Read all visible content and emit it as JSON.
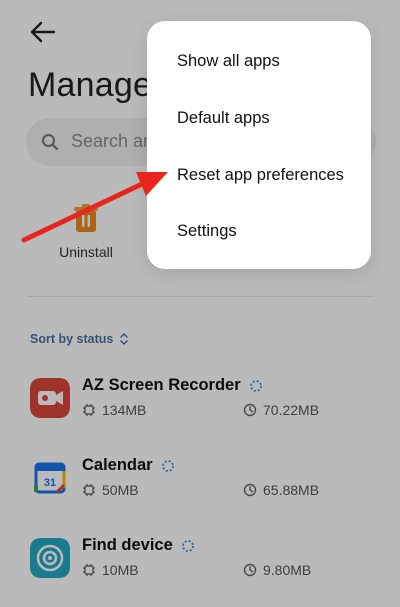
{
  "page": {
    "title": "Manage",
    "search_placeholder": "Search ar"
  },
  "actions": {
    "uninstall_label": "Uninstall"
  },
  "sort": {
    "label": "Sort by status"
  },
  "apps": [
    {
      "name": "AZ Screen Recorder",
      "storage": "134MB",
      "time": "70.22MB",
      "icon": "screen-recorder-icon",
      "color": "#d8463a"
    },
    {
      "name": "Calendar",
      "storage": "50MB",
      "time": "65.88MB",
      "icon": "calendar-icon",
      "color": "#1a73e8"
    },
    {
      "name": "Find device",
      "storage": "10MB",
      "time": "9.80MB",
      "icon": "find-device-icon",
      "color": "#26a9c3"
    }
  ],
  "menu": {
    "items": [
      "Show all apps",
      "Default apps",
      "Reset app preferences",
      "Settings"
    ]
  },
  "colors": {
    "accent": "#4a6fa5",
    "annotation_arrow": "#e8241c",
    "uninstall_icon": "#e9891e"
  }
}
